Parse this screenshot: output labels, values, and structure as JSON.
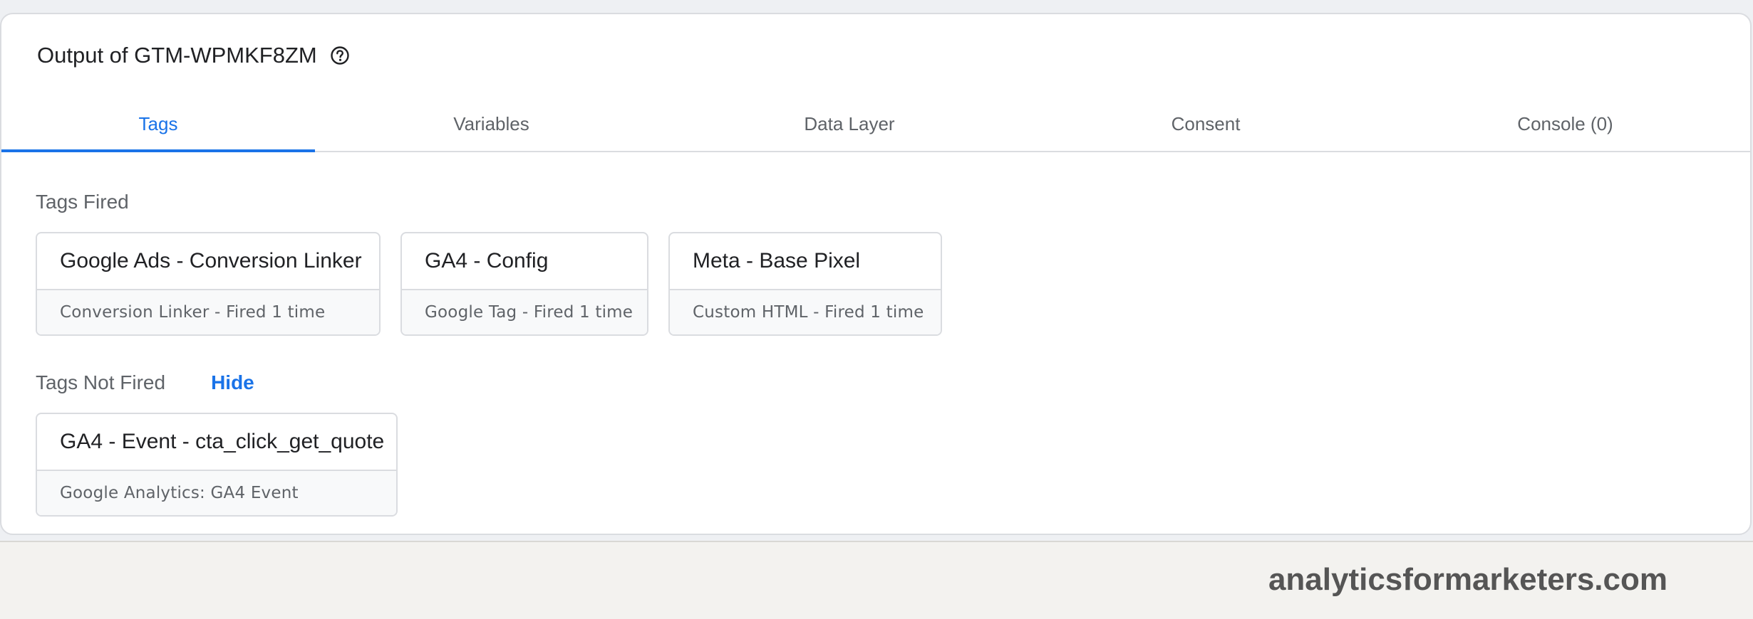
{
  "header": {
    "title": "Output of GTM-WPMKF8ZM",
    "help_icon": "help-circle-icon"
  },
  "tabs": [
    {
      "label": "Tags",
      "active": true
    },
    {
      "label": "Variables",
      "active": false
    },
    {
      "label": "Data Layer",
      "active": false
    },
    {
      "label": "Consent",
      "active": false
    },
    {
      "label": "Console (0)",
      "active": false
    }
  ],
  "tags_fired": {
    "title": "Tags Fired",
    "items": [
      {
        "name": "Google Ads - Conversion Linker",
        "detail": "Conversion Linker - Fired 1 time"
      },
      {
        "name": "GA4 - Config",
        "detail": "Google Tag - Fired 1 time"
      },
      {
        "name": "Meta - Base Pixel",
        "detail": "Custom HTML - Fired 1 time"
      }
    ]
  },
  "tags_not_fired": {
    "title": "Tags Not Fired",
    "toggle_label": "Hide",
    "items": [
      {
        "name": "GA4 - Event - cta_click_get_quote",
        "detail": "Google Analytics: GA4 Event"
      }
    ]
  },
  "footer": {
    "brand": "analyticsformarketers.com"
  },
  "colors": {
    "accent": "#1a73e8",
    "border": "#dadce0",
    "muted_text": "#5f6368"
  }
}
